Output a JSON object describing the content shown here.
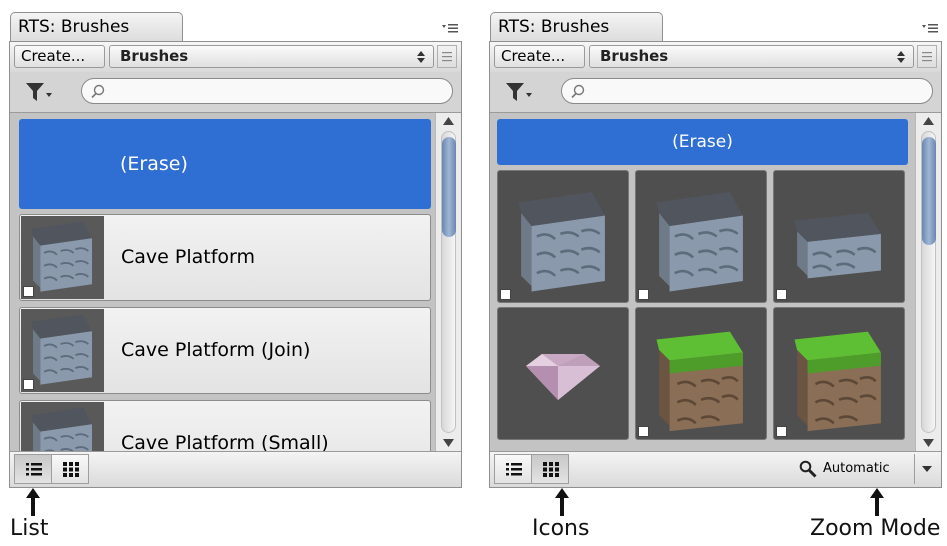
{
  "panels": {
    "list": {
      "title": "RTS: Brushes",
      "create_label": "Create...",
      "category": "Brushes",
      "erase_label": "(Erase)",
      "items": [
        {
          "label": "Cave Platform"
        },
        {
          "label": "Cave Platform (Join)"
        },
        {
          "label": "Cave Platform (Small)"
        }
      ]
    },
    "icons": {
      "title": "RTS: Brushes",
      "create_label": "Create...",
      "category": "Brushes",
      "erase_label": "(Erase)",
      "zoom_mode": "Automatic",
      "tiles": [
        {
          "icon": "stone-cube-icon"
        },
        {
          "icon": "stone-cube-icon"
        },
        {
          "icon": "stone-slab-icon"
        },
        {
          "icon": "gem-icon"
        },
        {
          "icon": "grass-cube-icon"
        },
        {
          "icon": "grass-cube-icon"
        }
      ]
    }
  },
  "captions": {
    "list": "List",
    "icons": "Icons",
    "zoom": "Zoom Mode"
  },
  "colors": {
    "selection_blue": "#2f6fd3",
    "thumb_bg": "#4f4f4f",
    "grass": "#5fbf34",
    "stone": "#7f8fa0"
  }
}
